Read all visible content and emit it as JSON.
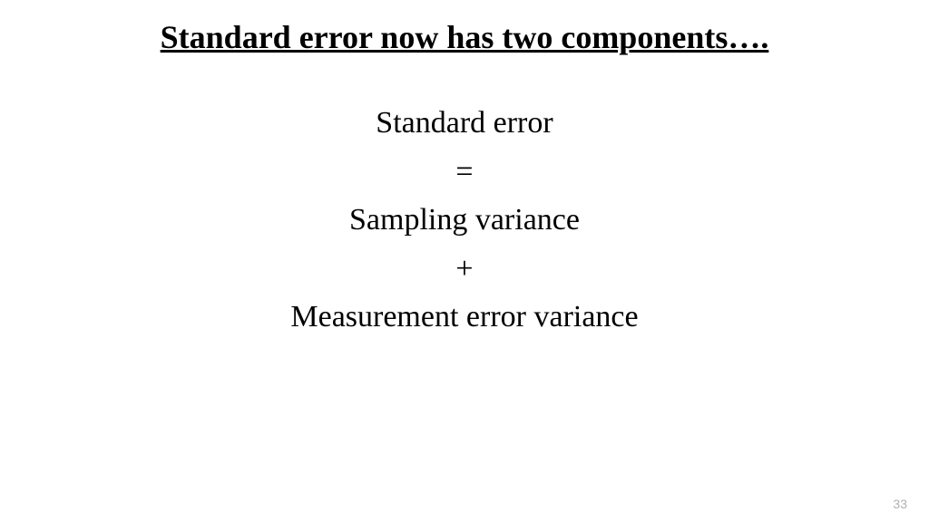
{
  "slide": {
    "title": "Standard error now has two components….",
    "lines": {
      "line1": "Standard error",
      "line2": "=",
      "line3": "Sampling variance",
      "line4": "+",
      "line5": "Measurement error variance"
    },
    "page_number": "33"
  }
}
